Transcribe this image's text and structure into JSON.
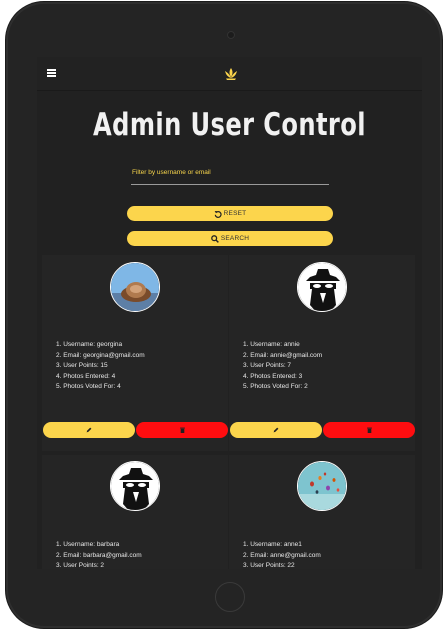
{
  "page": {
    "title": "Admin User Control"
  },
  "filter": {
    "placeholder": "Filter by username or email"
  },
  "buttons": {
    "reset_label": "RESET",
    "search_label": "SEARCH"
  },
  "colors": {
    "accent": "#fcd54c",
    "danger": "#ff0d10",
    "background": "#212121"
  },
  "icons": {
    "menu": "hamburger-icon",
    "logo": "lotus-icon",
    "reset": "reset-icon",
    "search": "search-icon",
    "edit": "pencil-icon",
    "delete": "trash-icon"
  },
  "users": [
    {
      "username": "1. Username: georgina",
      "email": "2. Email: georgina@gmail.com",
      "points": "3. User Points: 15",
      "entered": "4. Photos Entered: 4",
      "voted": "5. Photos Voted For: 4"
    },
    {
      "username": "1. Username: annie",
      "email": "2. Email: annie@gmail.com",
      "points": "3. User Points: 7",
      "entered": "4. Photos Entered: 3",
      "voted": "5. Photos Voted For: 2"
    },
    {
      "username": "1. Username: barbara",
      "email": "2. Email: barbara@gmail.com",
      "points": "3. User Points: 2"
    },
    {
      "username": "1. Username: anne1",
      "email": "2. Email: anne@gmail.com",
      "points": "3. User Points: 22"
    }
  ]
}
